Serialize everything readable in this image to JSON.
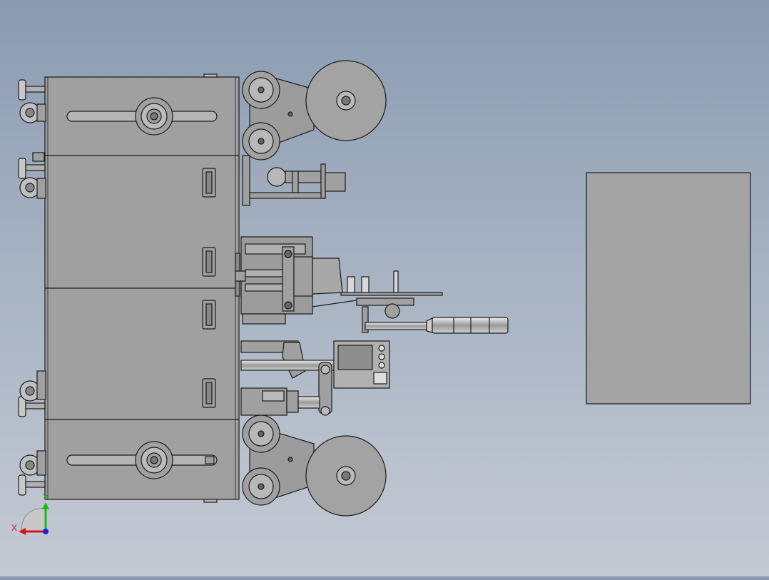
{
  "viewport": {
    "title": "",
    "background_top": "#8a9bb2",
    "background_bottom": "#c4cad4"
  },
  "model": {
    "body_color": "#a0a0a0",
    "edge_color": "#1a1a1a",
    "panel_color": "#a3a3a3"
  },
  "triad": {
    "x_label": "X",
    "y_label": "Y",
    "x_color": "#d01818",
    "y_color": "#18b818",
    "z_color": "#2020d0"
  }
}
